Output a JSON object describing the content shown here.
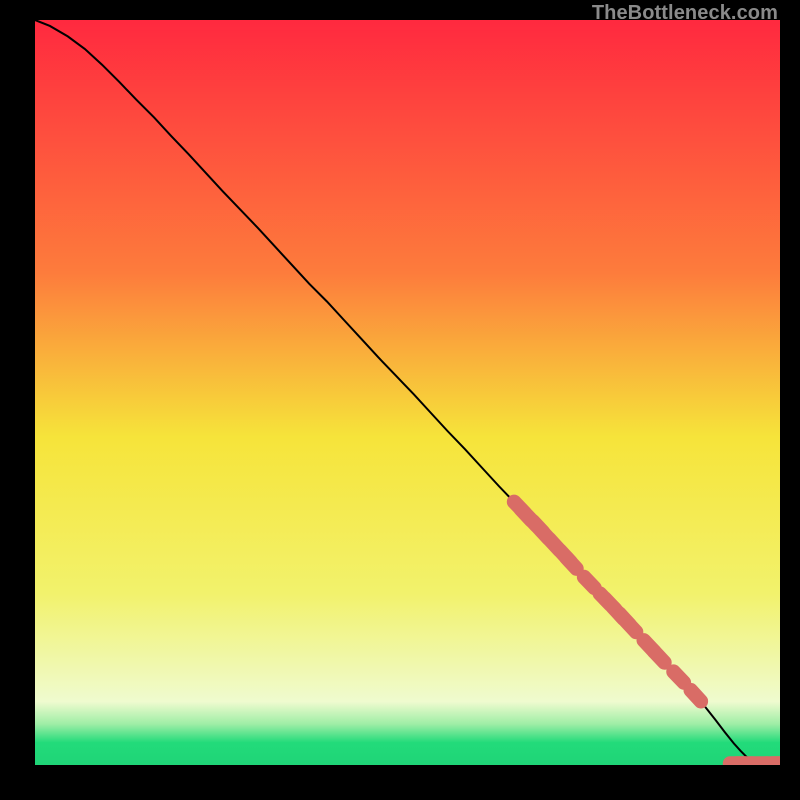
{
  "watermark": {
    "text": "TheBottleneck.com"
  },
  "palette": {
    "marker": "#d96c66",
    "curve": "#000000",
    "green": "#22db7a",
    "yellow": "#f6ea3a",
    "orange": "#f9a63b",
    "red": "#ff293f",
    "black": "#000000"
  },
  "chart_data": {
    "type": "line",
    "title": "",
    "xlabel": "",
    "ylabel": "",
    "xlim": [
      0,
      100
    ],
    "ylim": [
      0,
      100
    ],
    "grid": false,
    "legend": false,
    "background_gradient": {
      "stops": [
        {
          "offset": 0.0,
          "color": "#ff293f"
        },
        {
          "offset": 0.34,
          "color": "#fd7c3c"
        },
        {
          "offset": 0.56,
          "color": "#f6e43a"
        },
        {
          "offset": 0.77,
          "color": "#f2f26c"
        },
        {
          "offset": 0.915,
          "color": "#effbcf"
        },
        {
          "offset": 0.945,
          "color": "#9feea6"
        },
        {
          "offset": 0.97,
          "color": "#22db7a"
        },
        {
          "offset": 1.0,
          "color": "#1fd477"
        }
      ]
    },
    "series": [
      {
        "name": "curve",
        "color": "#000000",
        "x": [
          0.0,
          2.0,
          4.4,
          6.7,
          9.0,
          11.3,
          13.6,
          16.0,
          18.3,
          20.6,
          22.9,
          25.2,
          27.6,
          29.9,
          32.2,
          34.5,
          36.8,
          39.2,
          41.5,
          43.8,
          46.1,
          48.4,
          50.8,
          53.1,
          55.4,
          57.7,
          60.0,
          62.3,
          64.7,
          67.0,
          69.3,
          71.6,
          73.9,
          76.3,
          78.6,
          80.9,
          83.2,
          85.5,
          87.9,
          89.8,
          91.3,
          92.6,
          93.8,
          94.7,
          95.5,
          96.3,
          97.2,
          98.3,
          100.0
        ],
        "y": [
          100.0,
          99.2,
          97.8,
          96.1,
          94.0,
          91.7,
          89.3,
          86.9,
          84.4,
          82.0,
          79.5,
          77.0,
          74.5,
          72.1,
          69.6,
          67.1,
          64.6,
          62.2,
          59.7,
          57.2,
          54.7,
          52.3,
          49.8,
          47.3,
          44.8,
          42.4,
          39.9,
          37.4,
          34.9,
          32.5,
          30.0,
          27.5,
          25.0,
          22.6,
          20.1,
          17.6,
          15.1,
          12.7,
          10.2,
          8.0,
          6.1,
          4.4,
          2.9,
          1.9,
          1.1,
          0.6,
          0.3,
          0.2,
          0.2
        ]
      }
    ],
    "markers": {
      "color": "#d96c66",
      "points": [
        {
          "x": 65.0,
          "y": 34.6
        },
        {
          "x": 65.9,
          "y": 33.6
        },
        {
          "x": 66.6,
          "y": 32.9
        },
        {
          "x": 67.5,
          "y": 32.0
        },
        {
          "x": 68.2,
          "y": 31.2
        },
        {
          "x": 69.7,
          "y": 29.6
        },
        {
          "x": 71.2,
          "y": 28.0
        },
        {
          "x": 72.0,
          "y": 27.1
        },
        {
          "x": 74.4,
          "y": 24.5
        },
        {
          "x": 76.5,
          "y": 22.3
        },
        {
          "x": 77.2,
          "y": 21.6
        },
        {
          "x": 78.3,
          "y": 20.4
        },
        {
          "x": 79.1,
          "y": 19.6
        },
        {
          "x": 80.0,
          "y": 18.6
        },
        {
          "x": 82.4,
          "y": 16.0
        },
        {
          "x": 83.8,
          "y": 14.5
        },
        {
          "x": 86.4,
          "y": 11.8
        },
        {
          "x": 88.7,
          "y": 9.3
        },
        {
          "x": 94.3,
          "y": 0.21
        },
        {
          "x": 95.2,
          "y": 0.21
        },
        {
          "x": 97.2,
          "y": 0.21
        },
        {
          "x": 99.2,
          "y": 0.21
        },
        {
          "x": 100.0,
          "y": 0.21
        }
      ]
    }
  }
}
